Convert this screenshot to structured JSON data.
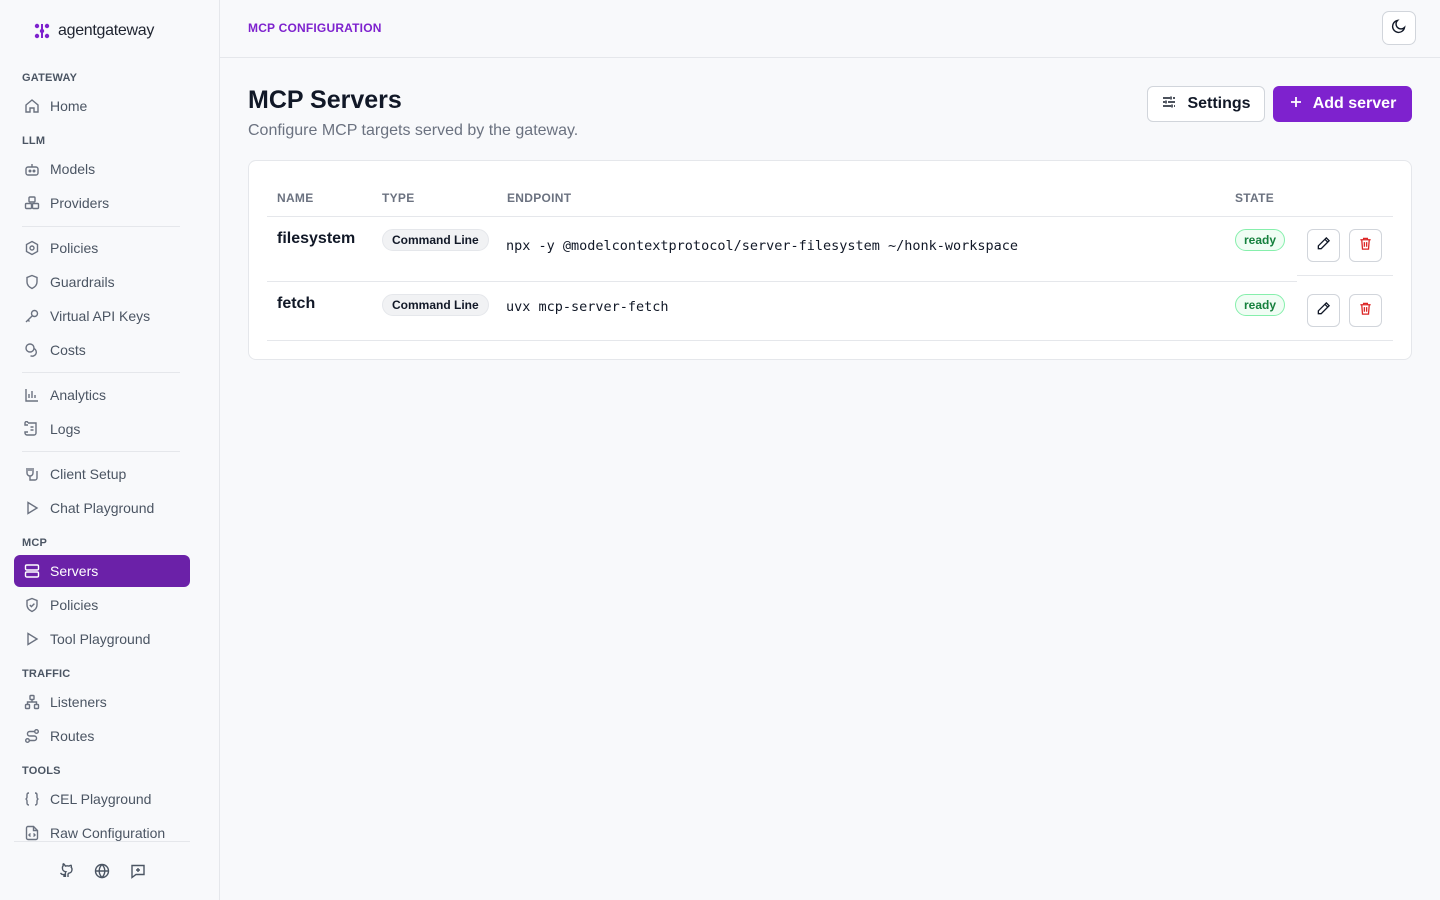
{
  "brand": {
    "name": "agentgateway"
  },
  "sidebar": {
    "sections": {
      "gateway": "GATEWAY",
      "llm": "LLM",
      "mcp": "MCP",
      "traffic": "TRAFFIC",
      "tools": "TOOLS"
    },
    "items": {
      "home": "Home",
      "models": "Models",
      "providers": "Providers",
      "policies": "Policies",
      "guardrails": "Guardrails",
      "virtual_api_keys": "Virtual API Keys",
      "costs": "Costs",
      "analytics": "Analytics",
      "logs": "Logs",
      "client_setup": "Client Setup",
      "chat_playground": "Chat Playground",
      "servers": "Servers",
      "mcp_policies": "Policies",
      "tool_playground": "Tool Playground",
      "listeners": "Listeners",
      "routes": "Routes",
      "cel_playground": "CEL Playground",
      "raw_configuration": "Raw Configuration"
    },
    "active": "servers"
  },
  "header": {
    "breadcrumb": "MCP CONFIGURATION"
  },
  "main": {
    "title": "MCP Servers",
    "subtitle": "Configure MCP targets served by the gateway.",
    "settings_label": "Settings",
    "add_label": "Add server",
    "columns": {
      "name": "NAME",
      "type": "TYPE",
      "endpoint": "ENDPOINT",
      "state": "STATE"
    },
    "rows": [
      {
        "name": "filesystem",
        "type": "Command Line",
        "endpoint": "npx -y @modelcontextprotocol/server-filesystem ~/honk-workspace",
        "state": "ready"
      },
      {
        "name": "fetch",
        "type": "Command Line",
        "endpoint": "uvx mcp-server-fetch",
        "state": "ready"
      }
    ]
  },
  "colors": {
    "accent": "#7e22ce",
    "active_nav": "#6b21a8",
    "ready": "#15803d",
    "danger": "#dc2626"
  }
}
